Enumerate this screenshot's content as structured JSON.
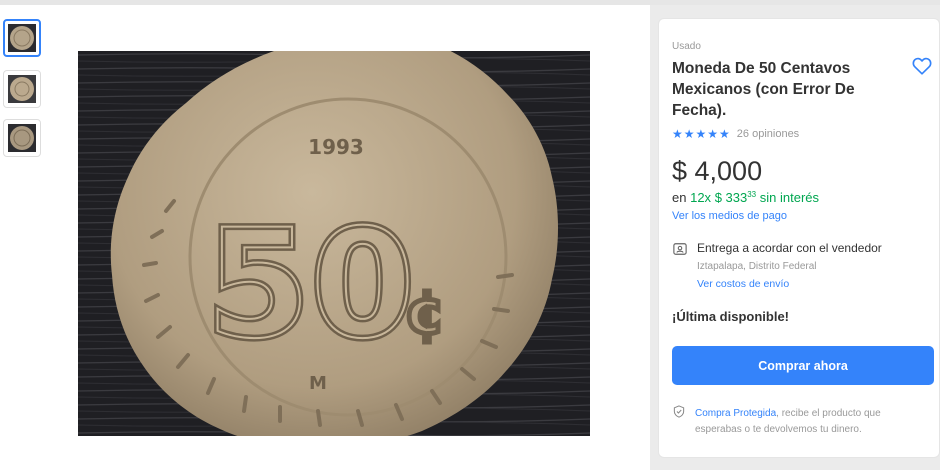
{
  "product": {
    "condition": "Usado",
    "title": "Moneda De 50 Centavos Mexicanos (con Error De Fecha).",
    "rating": {
      "stars": 5,
      "stars_glyphs": "★★★★★",
      "reviews_text": "26 opiniones"
    },
    "price": "$ 4,000",
    "installments": {
      "prefix": "en",
      "count": "12x",
      "amount": "$ 333",
      "cents": "33",
      "suffix": "sin interés"
    },
    "payment_methods_link": "Ver los medios de pago"
  },
  "shipping": {
    "title": "Entrega a acordar con el vendedor",
    "location": "Iztapalapa, Distrito Federal",
    "costs_link": "Ver costos de envío"
  },
  "stock_text": "¡Última disponible!",
  "buy_button_label": "Comprar ahora",
  "protection": {
    "link": "Compra Protegida",
    "text": ", recibe el producto que esperabas o te devolvemos tu dinero."
  },
  "gallery": {
    "thumbnails": [
      {
        "name": "coin-photo-1",
        "selected": true
      },
      {
        "name": "coin-photo-2",
        "selected": false
      },
      {
        "name": "coin-photo-3",
        "selected": false
      }
    ],
    "main_image": {
      "coin_year": "1993",
      "coin_value": "50",
      "coin_unit": "¢",
      "mint_mark": "M"
    }
  },
  "icons": {
    "favorite": "heart-icon",
    "shipping": "contact-card-icon",
    "protection": "shield-icon"
  },
  "colors": {
    "accent": "#3483fa",
    "green": "#00a650",
    "muted": "#999999",
    "text": "#333333"
  }
}
